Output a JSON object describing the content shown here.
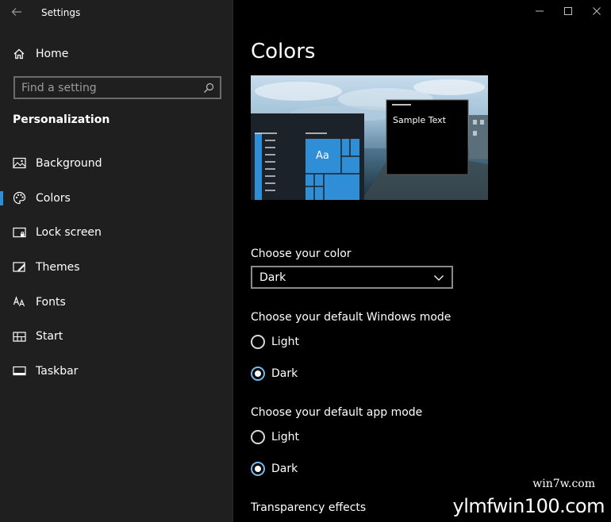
{
  "window": {
    "title": "Settings",
    "back_icon": "back-arrow-icon",
    "controls": [
      "minimize-icon",
      "maximize-icon",
      "close-icon"
    ]
  },
  "sidebar": {
    "home_label": "Home",
    "search_placeholder": "Find a setting",
    "section_title": "Personalization",
    "items": [
      {
        "label": "Background",
        "icon": "image-icon",
        "selected": false
      },
      {
        "label": "Colors",
        "icon": "palette-icon",
        "selected": true
      },
      {
        "label": "Lock screen",
        "icon": "lock-screen-icon",
        "selected": false
      },
      {
        "label": "Themes",
        "icon": "themes-icon",
        "selected": false
      },
      {
        "label": "Fonts",
        "icon": "fonts-icon",
        "selected": false
      },
      {
        "label": "Start",
        "icon": "start-icon",
        "selected": false
      },
      {
        "label": "Taskbar",
        "icon": "taskbar-icon",
        "selected": false
      }
    ]
  },
  "main": {
    "title": "Colors",
    "preview": {
      "tile_text": "Aa",
      "sample_text": "Sample Text"
    },
    "choose_color": {
      "label": "Choose your color",
      "selected": "Dark"
    },
    "windows_mode": {
      "label": "Choose your default Windows mode",
      "options": [
        {
          "label": "Light",
          "checked": false
        },
        {
          "label": "Dark",
          "checked": true
        }
      ]
    },
    "app_mode": {
      "label": "Choose your default app mode",
      "options": [
        {
          "label": "Light",
          "checked": false
        },
        {
          "label": "Dark",
          "checked": true
        }
      ]
    },
    "transparency": {
      "label": "Transparency effects"
    }
  },
  "watermark": {
    "small": "win7w.com",
    "big": "ylmfwin100.com"
  },
  "colors": {
    "accent": "#2f8ed6",
    "sidebar_bg": "#1f1f1f",
    "content_bg": "#000000"
  }
}
